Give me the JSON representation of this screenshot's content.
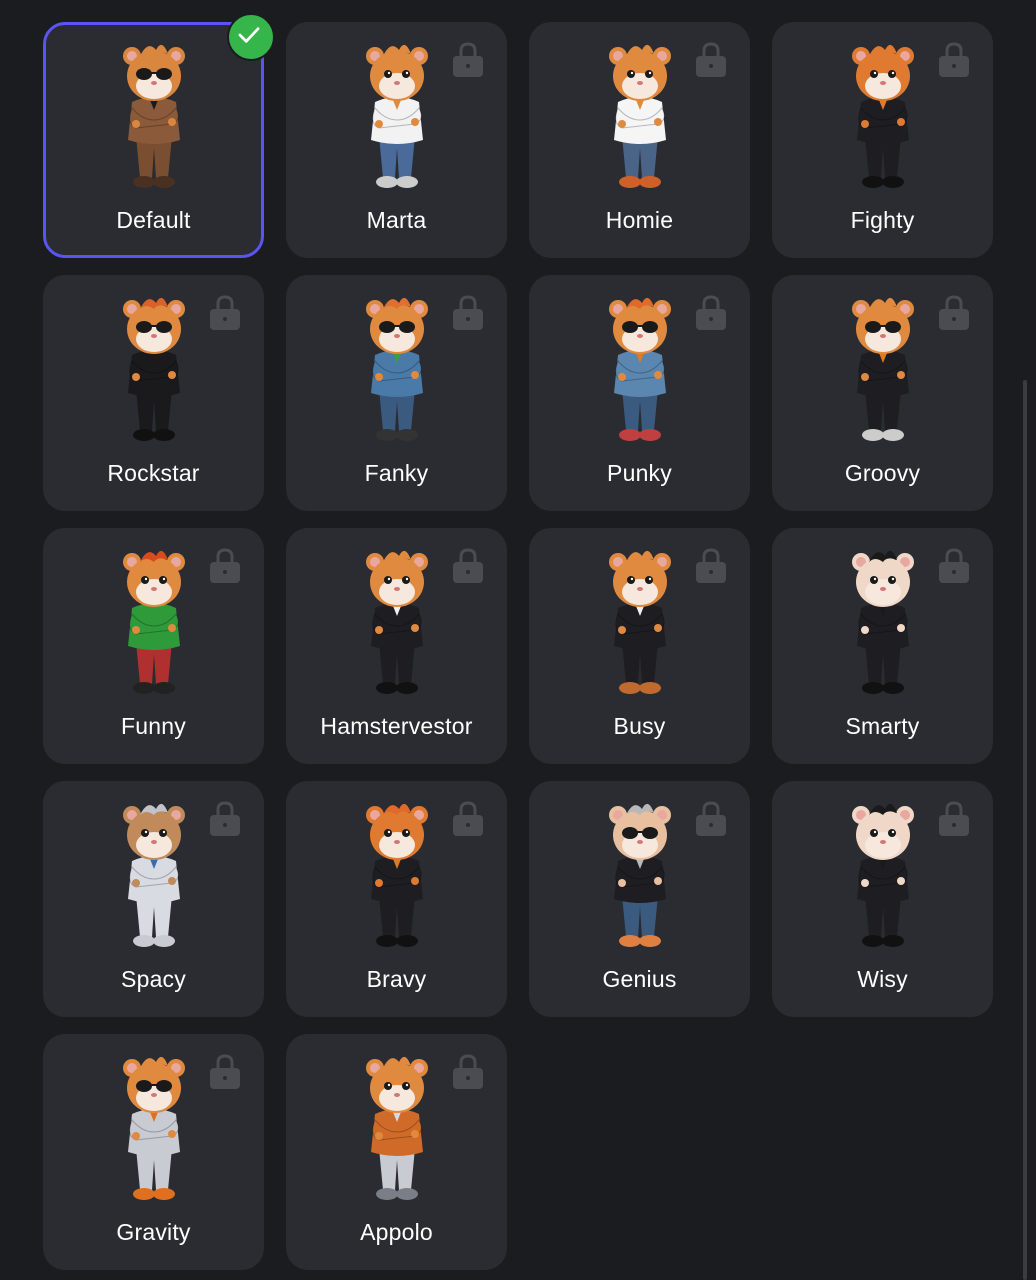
{
  "skins": [
    {
      "name": "Default",
      "selected": true,
      "locked": false,
      "icon": "check-circle-icon",
      "colors": {
        "fur": "#d9873e",
        "top": "#8a5a3a",
        "bottom": "#7a4e30",
        "shoes": "#4a3020",
        "hair": "#d9873e",
        "glasses": true,
        "accent": "#1a1a1a"
      }
    },
    {
      "name": "Marta",
      "selected": false,
      "locked": true,
      "icon": "lock-icon",
      "colors": {
        "fur": "#e08a40",
        "top": "#f2f2f2",
        "bottom": "#4a6a9a",
        "shoes": "#cccccc",
        "hair": "#e08a40",
        "glasses": false,
        "accent": "#e08a40"
      }
    },
    {
      "name": "Homie",
      "selected": false,
      "locked": true,
      "icon": "lock-icon",
      "colors": {
        "fur": "#e08a40",
        "top": "#f5f5f5",
        "bottom": "#4a6488",
        "shoes": "#d0602a",
        "hair": "#e08a40",
        "glasses": false,
        "accent": "#e08a40"
      }
    },
    {
      "name": "Fighty",
      "selected": false,
      "locked": true,
      "icon": "lock-icon",
      "colors": {
        "fur": "#e07a30",
        "top": "#1e1e22",
        "bottom": "#1e1e22",
        "shoes": "#111111",
        "hair": "#e07a30",
        "glasses": false,
        "accent": "#e07a30"
      }
    },
    {
      "name": "Rockstar",
      "selected": false,
      "locked": true,
      "icon": "lock-icon",
      "colors": {
        "fur": "#e08a40",
        "top": "#1a1a1c",
        "bottom": "#1a1a1c",
        "shoes": "#111111",
        "hair": "#d8622a",
        "glasses": true,
        "accent": "#1a1a1a"
      }
    },
    {
      "name": "Fanky",
      "selected": false,
      "locked": true,
      "icon": "lock-icon",
      "colors": {
        "fur": "#e08a40",
        "top": "#4a7aa8",
        "bottom": "#3a5a80",
        "shoes": "#333333",
        "hair": "#e07030",
        "glasses": true,
        "accent": "#3aa040"
      }
    },
    {
      "name": "Punky",
      "selected": false,
      "locked": true,
      "icon": "lock-icon",
      "colors": {
        "fur": "#e08a40",
        "top": "#5a86b0",
        "bottom": "#3a5a80",
        "shoes": "#c04040",
        "hair": "#e06a28",
        "glasses": true,
        "accent": "#e07a20"
      }
    },
    {
      "name": "Groovy",
      "selected": false,
      "locked": true,
      "icon": "lock-icon",
      "colors": {
        "fur": "#e08a40",
        "top": "#1e1e22",
        "bottom": "#1e1e22",
        "shoes": "#cccccc",
        "hair": "#e08a40",
        "glasses": true,
        "accent": "#e07a20"
      }
    },
    {
      "name": "Funny",
      "selected": false,
      "locked": true,
      "icon": "lock-icon",
      "colors": {
        "fur": "#e08a40",
        "top": "#2e9a3a",
        "bottom": "#b03030",
        "shoes": "#222222",
        "hair": "#d84a20",
        "glasses": false,
        "accent": "#2e9a3a"
      }
    },
    {
      "name": "Hamstervestor",
      "selected": false,
      "locked": true,
      "icon": "lock-icon",
      "colors": {
        "fur": "#e08a40",
        "top": "#1e1e22",
        "bottom": "#1e1e22",
        "shoes": "#111111",
        "hair": "#e08a40",
        "glasses": false,
        "accent": "#f0f0f0"
      }
    },
    {
      "name": "Busy",
      "selected": false,
      "locked": true,
      "icon": "lock-icon",
      "colors": {
        "fur": "#e08a40",
        "top": "#1e1e22",
        "bottom": "#1e1e22",
        "shoes": "#c06a30",
        "hair": "#e08a40",
        "glasses": false,
        "accent": "#f0f0f0"
      }
    },
    {
      "name": "Smarty",
      "selected": false,
      "locked": true,
      "icon": "lock-icon",
      "colors": {
        "fur": "#f0d8c8",
        "top": "#1e1e22",
        "bottom": "#1e1e22",
        "shoes": "#111111",
        "hair": "#1a1a1a",
        "glasses": false,
        "accent": "#1a1a1a"
      }
    },
    {
      "name": "Spacy",
      "selected": false,
      "locked": true,
      "icon": "lock-icon",
      "colors": {
        "fur": "#c08a5a",
        "top": "#d8dce2",
        "bottom": "#d8dce2",
        "shoes": "#c8ccd2",
        "hair": "#c0c4ca",
        "glasses": false,
        "accent": "#3a6ab0"
      }
    },
    {
      "name": "Bravy",
      "selected": false,
      "locked": true,
      "icon": "lock-icon",
      "colors": {
        "fur": "#e07a30",
        "top": "#1e1e22",
        "bottom": "#1e1e22",
        "shoes": "#111111",
        "hair": "#e06a28",
        "glasses": false,
        "accent": "#e07a20"
      }
    },
    {
      "name": "Genius",
      "selected": false,
      "locked": true,
      "icon": "lock-icon",
      "colors": {
        "fur": "#e8c0a0",
        "top": "#1e1e22",
        "bottom": "#3a5a80",
        "shoes": "#e08040",
        "hair": "#b8b8b8",
        "glasses": true,
        "accent": "#b8b8b8"
      }
    },
    {
      "name": "Wisy",
      "selected": false,
      "locked": true,
      "icon": "lock-icon",
      "colors": {
        "fur": "#f0d8c8",
        "top": "#1e1e22",
        "bottom": "#1e1e22",
        "shoes": "#111111",
        "hair": "#1a1a1a",
        "glasses": false,
        "accent": "#1a1a1a"
      }
    },
    {
      "name": "Gravity",
      "selected": false,
      "locked": true,
      "icon": "lock-icon",
      "colors": {
        "fur": "#e08a40",
        "top": "#c8ccd2",
        "bottom": "#c8ccd2",
        "shoes": "#e07020",
        "hair": "#e08a40",
        "glasses": true,
        "accent": "#e07020"
      }
    },
    {
      "name": "Appolo",
      "selected": false,
      "locked": true,
      "icon": "lock-icon",
      "colors": {
        "fur": "#e08a40",
        "top": "#d06a28",
        "bottom": "#c8ccd2",
        "shoes": "#7a7e86",
        "hair": "#e08a40",
        "glasses": false,
        "accent": "#d8dce2"
      }
    }
  ],
  "theme": {
    "background": "#1b1c20",
    "card": "#2a2c31",
    "selected_border": "#5a54f4",
    "check": "#35b54a",
    "lock": "#4a4c52",
    "text": "#ffffff"
  }
}
